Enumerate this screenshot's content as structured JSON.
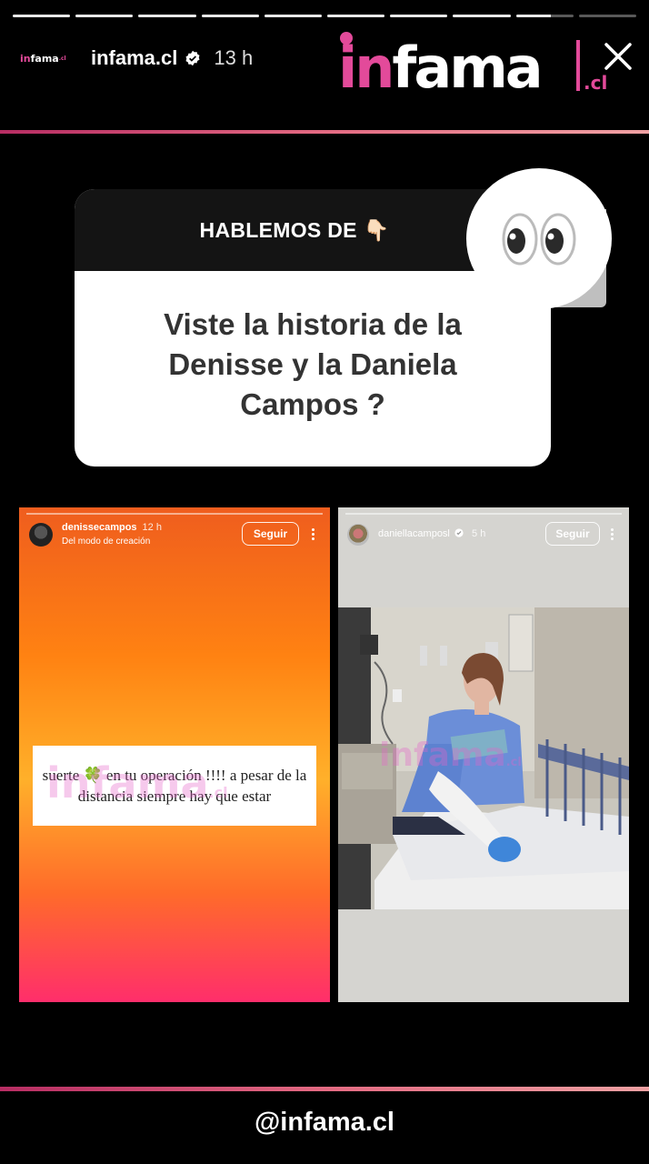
{
  "story": {
    "progress_segments": [
      1,
      1,
      1,
      1,
      1,
      1,
      1,
      1,
      0.6,
      0
    ],
    "account": "infama.cl",
    "time": "13 h",
    "mini_logo": {
      "brand": "infama",
      "tld": ".cl"
    },
    "brand_logo": {
      "brand": "infama",
      "tld": ".cl"
    }
  },
  "question_card": {
    "header": "HABLEMOS DE 👇🏻",
    "question": "Viste la historia  de la Denisse y la Daniela Campos ?",
    "emoji": "👀"
  },
  "left_story": {
    "username": "denissecampos",
    "time": "12 h",
    "subtitle": "Del modo de creación",
    "follow_label": "Seguir",
    "note": "suerte 🍀 en tu  operación  !!!! a pesar de la distancia siempre hay que estar",
    "watermark": {
      "brand": "infama",
      "tld": ".cl"
    }
  },
  "right_story": {
    "username": "daniellacamposl",
    "time": "5 h",
    "follow_label": "Seguir",
    "watermark": {
      "brand": "infama",
      "tld": ".cl"
    }
  },
  "footer": {
    "handle": "@infama.cl"
  },
  "colors": {
    "accent_pink": "#e34a9a",
    "gradient_line": [
      "#b72d63",
      "#e36a82",
      "#f1a1a3"
    ]
  },
  "icons": [
    "verified-badge-icon",
    "close-icon",
    "more-options-icon",
    "eyes-emoji-icon"
  ]
}
